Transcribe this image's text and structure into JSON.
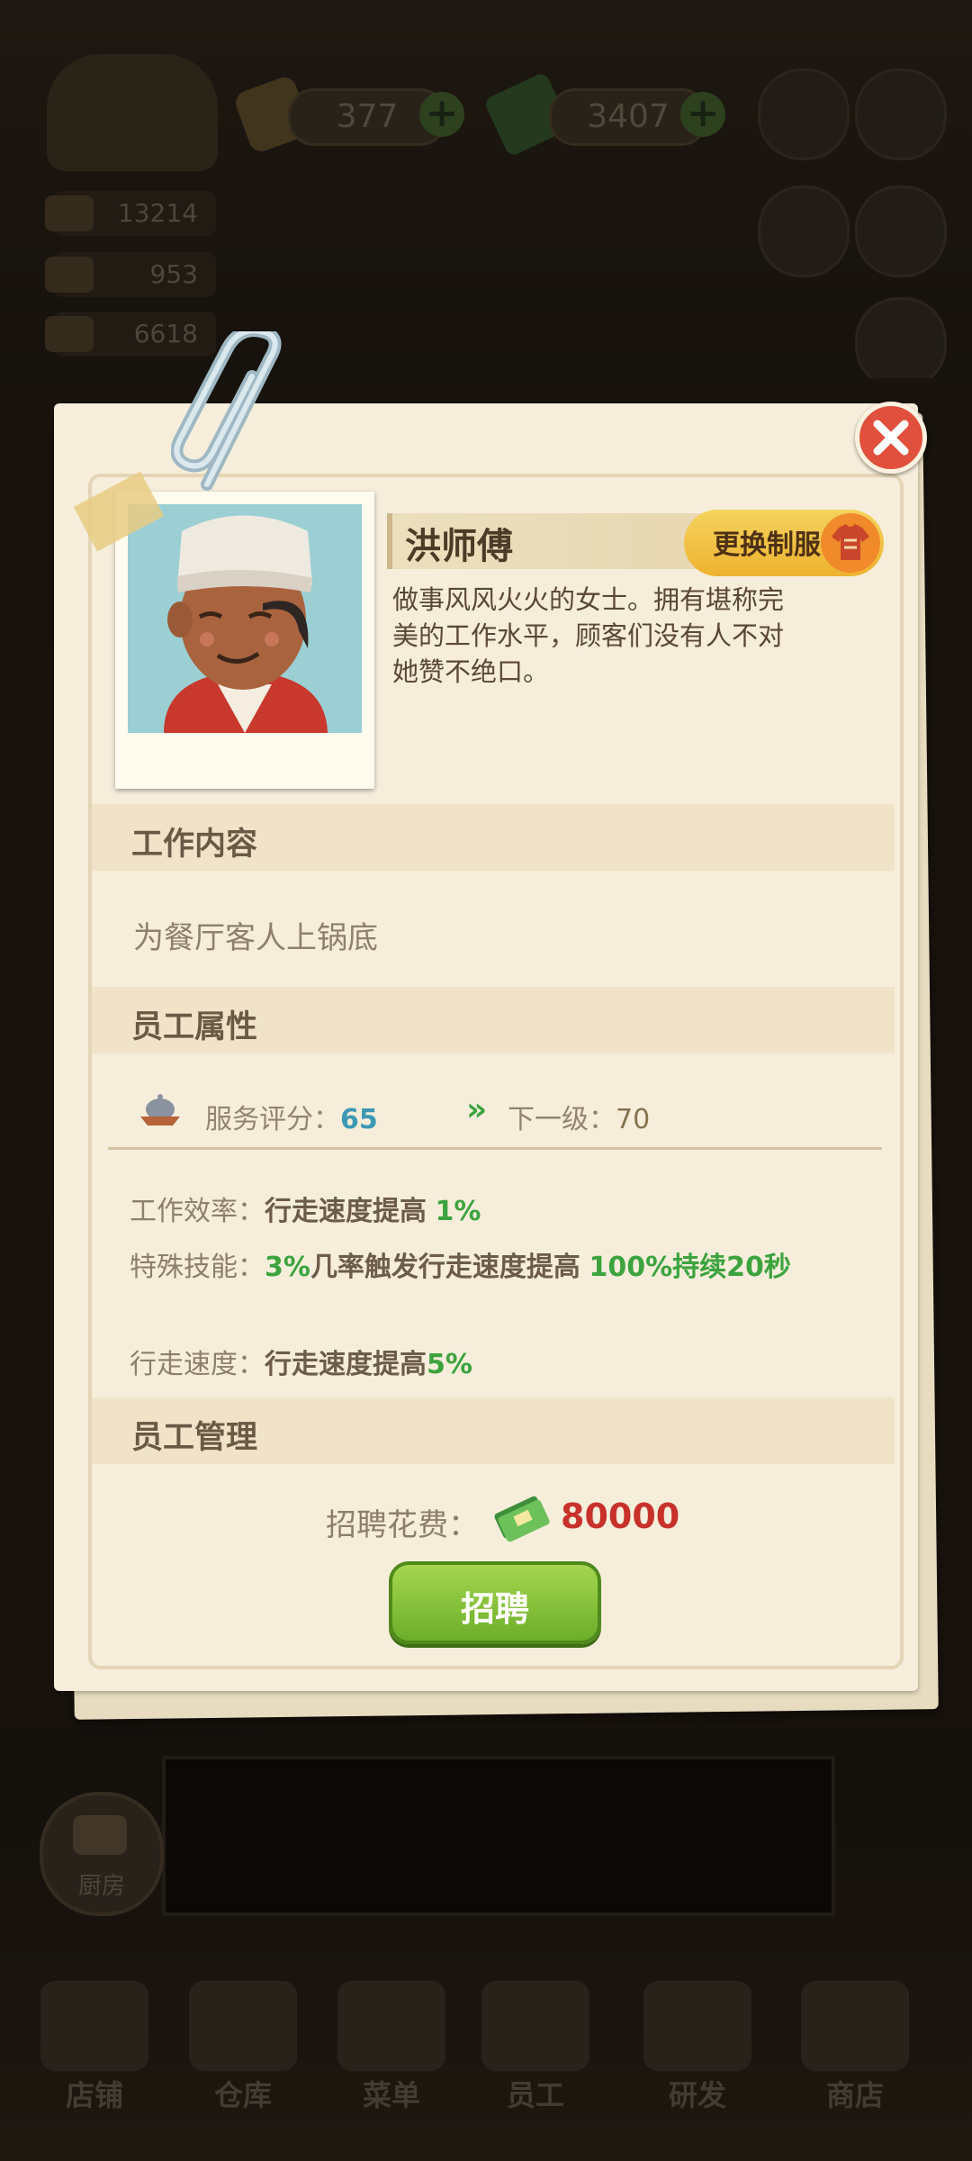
{
  "hud": {
    "coins": "377",
    "cash": "3407",
    "stats": [
      "13214",
      "953",
      "6618"
    ]
  },
  "dialog": {
    "staff_name": "洪师傅",
    "change_uniform_label": "更换制服",
    "description": "做事风风火火的女士。拥有堪称完美的工作水平，顾客们没有人不对她赞不绝口。",
    "sections": {
      "job_content_title": "工作内容",
      "job_content_text": "为餐厅客人上锅底",
      "attributes_title": "员工属性",
      "management_title": "员工管理"
    },
    "attributes": {
      "service_label": "服务评分：",
      "service_value": "65",
      "next_level_label": "下一级：",
      "next_level_value": "70",
      "efficiency_label": "工作效率：",
      "efficiency_text": "行走速度提高",
      "efficiency_value": "1%",
      "skill_label": "特殊技能：",
      "skill_chance": "3%",
      "skill_text_1": "几率触发行走速度提高",
      "skill_value": "100%",
      "skill_text_2": "持续",
      "skill_duration": "20秒",
      "walk_label": "行走速度：",
      "walk_text": "行走速度提高",
      "walk_value": "5%"
    },
    "hire_cost_label": "招聘花费：",
    "hire_cost_value": "80000",
    "hire_button_label": "招聘"
  },
  "background": {
    "kitchen_label": "厨房",
    "nav": [
      "店铺",
      "仓库",
      "菜单",
      "员工",
      "研发",
      "商店"
    ]
  },
  "colors": {
    "accent_green": "#3ca33e",
    "value_blue": "#3d98b3",
    "cost_red": "#c8312a",
    "paper": "#f6eedb"
  }
}
